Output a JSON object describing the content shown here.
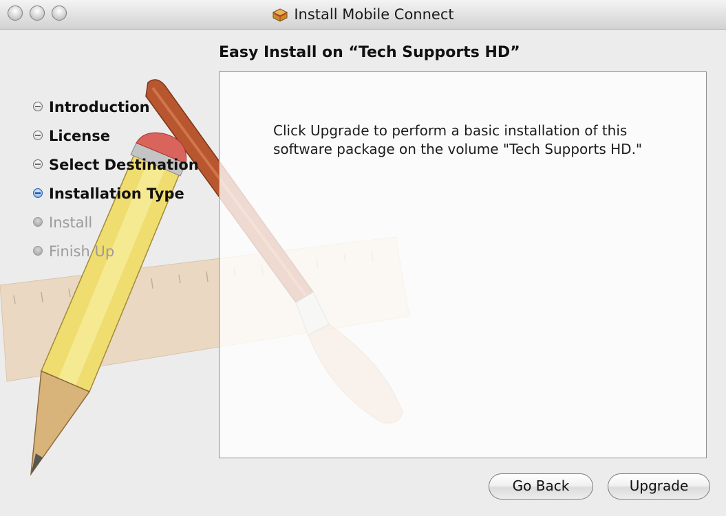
{
  "window": {
    "title": "Install Mobile Connect",
    "title_icon": "package-icon"
  },
  "heading": "Easy Install on “Tech Supports HD”",
  "steps": [
    {
      "label": "Introduction",
      "state": "done"
    },
    {
      "label": "License",
      "state": "done"
    },
    {
      "label": "Select Destination",
      "state": "done"
    },
    {
      "label": "Installation Type",
      "state": "current"
    },
    {
      "label": "Install",
      "state": "pending"
    },
    {
      "label": "Finish Up",
      "state": "pending"
    }
  ],
  "content": {
    "message": "Click Upgrade to perform a basic installation of this software package on the volume \"Tech Supports HD.\""
  },
  "buttons": {
    "back": "Go Back",
    "primary": "Upgrade"
  },
  "colors": {
    "current_step": "#2a5fae",
    "pending_step": "#9b9b9b"
  }
}
